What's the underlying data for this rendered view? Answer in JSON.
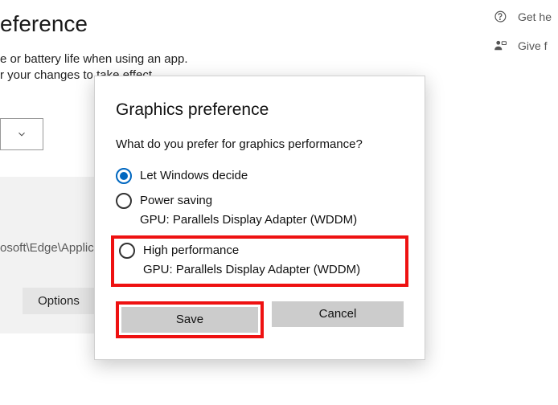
{
  "header": {
    "get_help": "Get he",
    "give_feedback": "Give f"
  },
  "bg": {
    "title": "eference",
    "sub1": "e or battery life when using an app.",
    "sub2": "r your changes to take effect.",
    "path_fragment": "osoft\\Edge\\Applicati",
    "options_label": "Options"
  },
  "dialog": {
    "title": "Graphics preference",
    "prompt": "What do you prefer for graphics performance?",
    "options": [
      {
        "label": "Let Windows decide",
        "sub": "",
        "selected": true
      },
      {
        "label": "Power saving",
        "sub": "GPU: Parallels Display Adapter (WDDM)",
        "selected": false
      },
      {
        "label": "High performance",
        "sub": "GPU: Parallels Display Adapter (WDDM)",
        "selected": false
      }
    ],
    "save_label": "Save",
    "cancel_label": "Cancel"
  }
}
